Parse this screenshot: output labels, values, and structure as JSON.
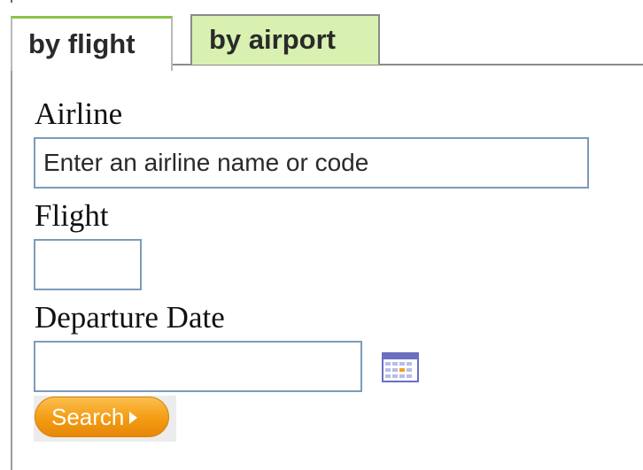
{
  "tabs": [
    {
      "label": "by flight",
      "active": true
    },
    {
      "label": "by airport",
      "active": false
    }
  ],
  "form": {
    "airline_label": "Airline",
    "airline_placeholder": "Enter an airline name or code",
    "airline_value": "",
    "flight_label": "Flight",
    "flight_value": "",
    "date_label": "Departure Date",
    "date_value": "",
    "calendar_icon": "calendar-icon",
    "search_label": "Search"
  },
  "colors": {
    "active_tab_top": "#8bc34a",
    "inactive_tab_bg": "#d8f1b0",
    "input_border": "#7d9bb8",
    "search_button": "#f39c12"
  }
}
